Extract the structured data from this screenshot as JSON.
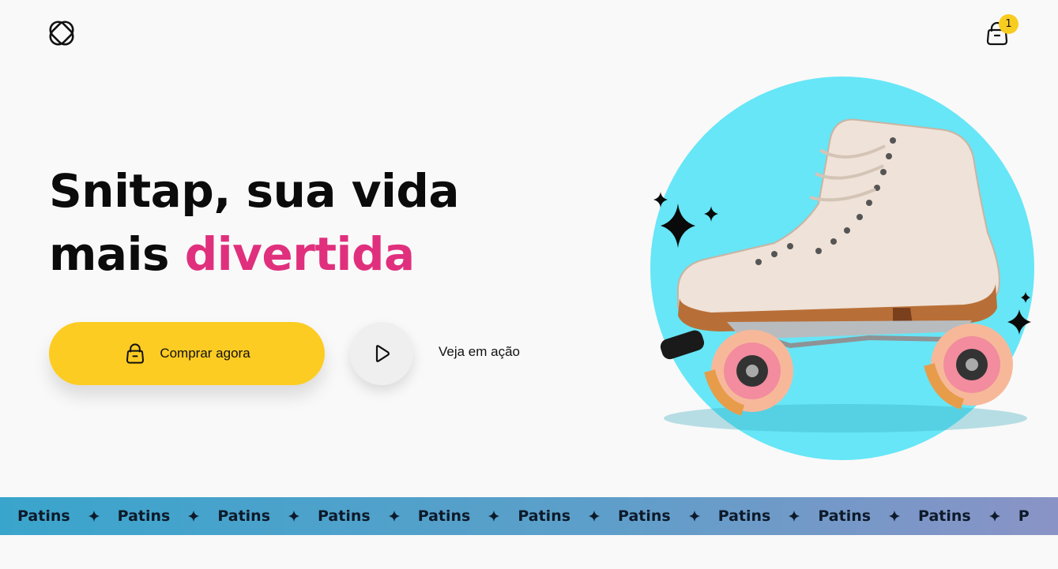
{
  "header": {
    "logo_icon": "snitap-logo-icon",
    "cart_icon": "shopping-bag-icon",
    "cart_count": "1"
  },
  "hero": {
    "title_line1": "Snitap, sua vida",
    "title_line2_plain": "mais",
    "title_line2_accent": "divertida",
    "buy_button_label": "Comprar agora",
    "buy_button_icon": "shopping-bag-icon",
    "play_button_icon": "play-icon",
    "watch_label": "Veja em ação",
    "image_subject": "roller-skate"
  },
  "ticker": {
    "items": [
      "Patins",
      "Patins",
      "Patins",
      "Patins",
      "Patins",
      "Patins",
      "Patins",
      "Patins",
      "Patins",
      "Patins",
      "P"
    ],
    "separator_icon": "sparkle-icon"
  },
  "colors": {
    "accent_pink": "#e0307d",
    "button_yellow": "#fdcc22",
    "badge_yellow": "#f8cd21",
    "circle_cyan": "#66e6f7",
    "ticker_start": "#3aa5cc",
    "ticker_end": "#8a93c6",
    "background": "#f9f9f9"
  }
}
